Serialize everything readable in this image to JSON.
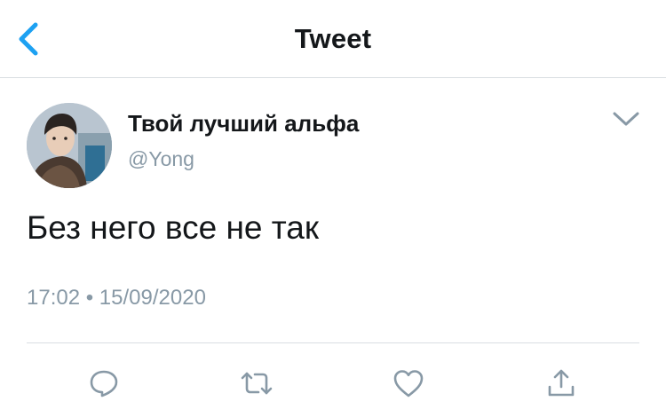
{
  "header": {
    "title": "Tweet",
    "back_icon": "chevron-left-icon"
  },
  "tweet": {
    "display_name": "Твой лучший альфа",
    "handle": "@Yong",
    "text": "Без него все не так",
    "time": "17:02",
    "separator": "•",
    "date": "15/09/2020",
    "timestamp": "17:02 • 15/09/2020",
    "menu_icon": "chevron-down-icon"
  },
  "actions": [
    {
      "name": "reply",
      "icon": "reply-bubble-icon"
    },
    {
      "name": "retweet",
      "icon": "retweet-icon"
    },
    {
      "name": "like",
      "icon": "heart-icon"
    },
    {
      "name": "share",
      "icon": "share-icon"
    }
  ],
  "colors": {
    "accent": "#1da1f2",
    "text": "#14171a",
    "secondary": "#8899a6",
    "divider": "#d9dee2"
  }
}
